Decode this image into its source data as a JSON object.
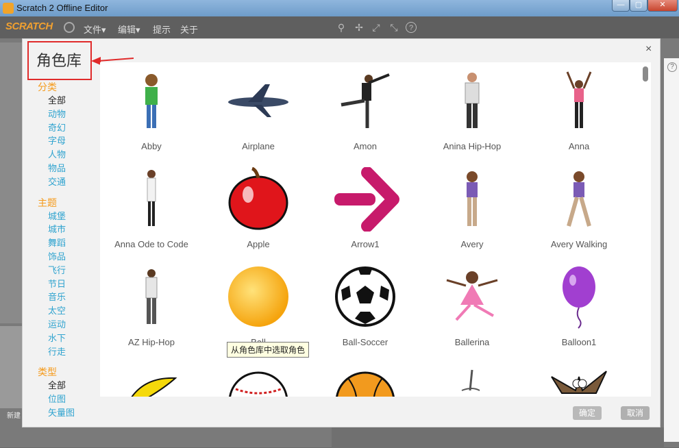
{
  "window": {
    "title": "Scratch 2 Offline Editor",
    "controls": {
      "minimize": "—",
      "maximize": "▢",
      "close": "✕"
    }
  },
  "menubar": {
    "logo": "SCRATCH",
    "items": [
      "文件▾",
      "编辑▾",
      "提示",
      "关于"
    ],
    "icons": [
      "stamp-icon",
      "cut-icon",
      "grow-icon",
      "shrink-icon",
      "help-icon"
    ]
  },
  "dialog": {
    "title": "角色库",
    "close": "×",
    "categories": [
      {
        "heading": "分类",
        "items": [
          "全部",
          "动物",
          "奇幻",
          "字母",
          "人物",
          "物品",
          "交通"
        ],
        "selected": 0
      },
      {
        "heading": "主题",
        "items": [
          "城堡",
          "城市",
          "舞蹈",
          "饰品",
          "飞行",
          "节日",
          "音乐",
          "太空",
          "运动",
          "水下",
          "行走"
        ],
        "selected": -1
      },
      {
        "heading": "类型",
        "items": [
          "全部",
          "位图",
          "矢量图"
        ],
        "selected": 0
      }
    ],
    "sprites": [
      "Abby",
      "Airplane",
      "Amon",
      "Anina Hip-Hop",
      "Anna",
      "Anna Ode to Code",
      "Apple",
      "Arrow1",
      "Avery",
      "Avery Walking",
      "AZ Hip-Hop",
      "Ball",
      "Ball-Soccer",
      "Ballerina",
      "Balloon1",
      "",
      "",
      "",
      "",
      ""
    ],
    "tooltip": "从角色库中选取角色",
    "ok_button": "确定",
    "cancel_button": "取消"
  },
  "colors": {
    "accent_orange": "#f59a1a",
    "link_blue": "#2fa3cf",
    "annotation_red": "#e02a2a"
  },
  "footer": {
    "new_sprite_label": "新建"
  }
}
